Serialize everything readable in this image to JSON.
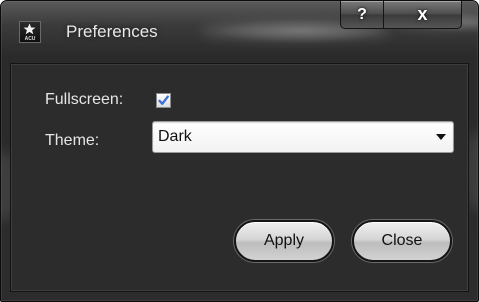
{
  "window": {
    "title": "Preferences",
    "app_icon": "acu-logo-icon",
    "app_icon_text": "ACU",
    "help_button_label": "?",
    "close_button_label": "x"
  },
  "form": {
    "fullscreen_label": "Fullscreen:",
    "fullscreen_checked": true,
    "theme_label": "Theme:",
    "theme_value": "Dark",
    "theme_arrow_icon": "dropdown-arrow-icon"
  },
  "buttons": {
    "apply_label": "Apply",
    "close_label": "Close"
  },
  "colors": {
    "frame": "#2c2c2c",
    "checkmark": "#3a6fd8",
    "text": "#e6e6e6"
  }
}
